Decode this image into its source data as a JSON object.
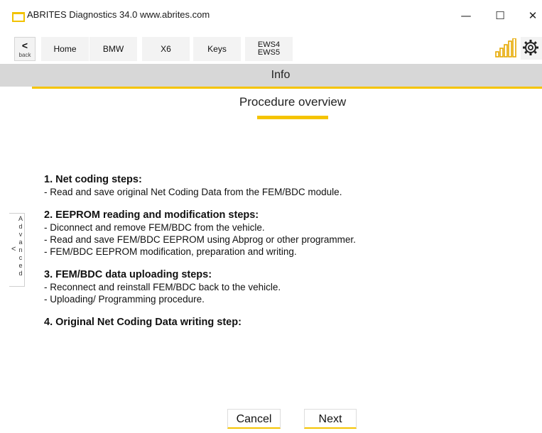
{
  "window": {
    "title": "ABRITES Diagnostics 34.0  www.abrites.com",
    "minimize_glyph": "—",
    "maximize_glyph": "☐",
    "close_glyph": "✕"
  },
  "nav": {
    "back_chevron": "<",
    "back_label": "back",
    "crumbs": [
      "Home",
      "BMW",
      "X6",
      "Keys"
    ],
    "crumb_multi": [
      "EWS4",
      "EWS5"
    ],
    "signal_icon": "signal-strength-icon",
    "settings_icon": "gear-icon"
  },
  "info": {
    "title": "Info"
  },
  "procedure": {
    "title": "Procedure overview",
    "sections": [
      {
        "heading": "1. Net coding steps:",
        "lines": [
          "- Read and save original Net Coding Data from the FEM/BDC module."
        ]
      },
      {
        "heading": "2. EEPROM reading and modification steps:",
        "lines": [
          "- Diconnect and remove FEM/BDC from the vehicle.",
          "- Read and save FEM/BDC EEPROM using Abprog or other programmer.",
          "- FEM/BDC EEPROM modification, preparation and writing."
        ]
      },
      {
        "heading": "3. FEM/BDC data uploading steps:",
        "lines": [
          "- Reconnect and reinstall FEM/BDC back to the vehicle.",
          "- Uploading/ Programming procedure."
        ]
      },
      {
        "heading": "4. Original Net Coding Data writing step:",
        "lines": []
      }
    ]
  },
  "advanced_tab": {
    "chevron": "<",
    "label": "Advanced"
  },
  "buttons": {
    "cancel": "Cancel",
    "next": "Next"
  },
  "colors": {
    "accent": "#f5c400",
    "band": "#d7d7d7",
    "crumb_bg": "#f3f3f3"
  }
}
